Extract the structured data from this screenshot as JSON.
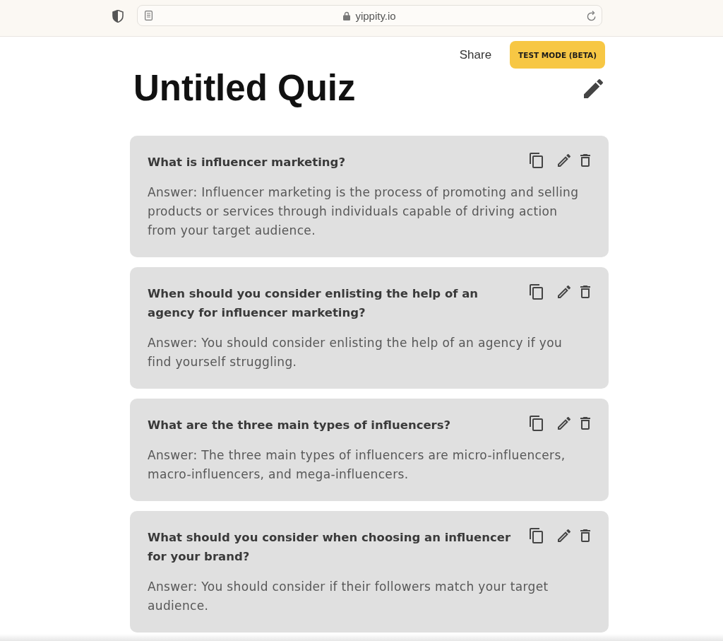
{
  "browser": {
    "address": "yippity.io"
  },
  "header": {
    "share": "Share",
    "test_mode_button": "TEST MODE (BETA)"
  },
  "title": "Untitled Quiz",
  "questions": [
    {
      "question": "What is influencer marketing?",
      "answer": "Answer: Influencer marketing is the process of promoting and selling products or services through individuals capable of driving action from your target audience."
    },
    {
      "question": "When should you consider enlisting the help of an agency for influencer marketing?",
      "answer": "Answer: You should consider enlisting the help of an agency if you find yourself struggling."
    },
    {
      "question": "What are the three main types of influencers?",
      "answer": "Answer: The three main types of influencers are micro-influencers, macro-influencers, and mega-influencers."
    },
    {
      "question": "What should you consider when choosing an influencer for your brand?",
      "answer": "Answer: You should consider if their followers match your target audience."
    }
  ]
}
